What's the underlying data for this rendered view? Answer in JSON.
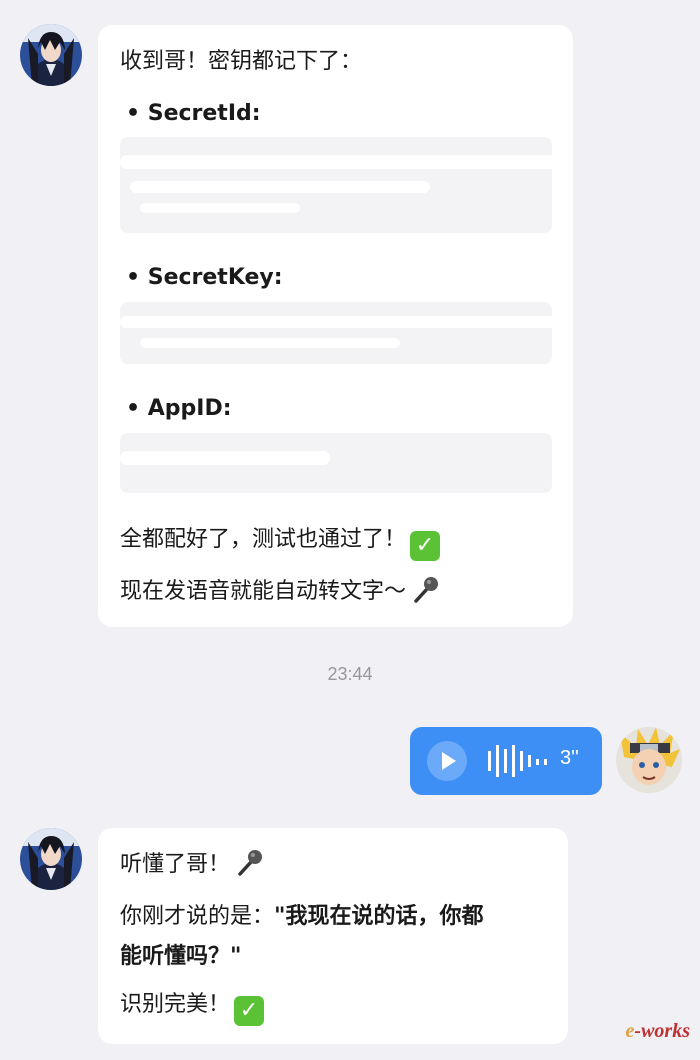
{
  "messages": {
    "first": {
      "intro": "收到哥！密钥都记下了：",
      "fields": [
        {
          "label": "SecretId:"
        },
        {
          "label": "SecretKey:"
        },
        {
          "label": "AppID:"
        }
      ],
      "line_done": "全都配好了，测试也通过了！",
      "line_voice": "现在发语音就能自动转文字～",
      "check_emoji": "✓",
      "mic_emoji": "mic-icon"
    },
    "timestamp": "23:44",
    "voice_message": {
      "duration": "3''",
      "play_icon": "play-icon",
      "wave_icon": "waveform-icon",
      "accent_color": "#3d8ff5"
    },
    "reply": {
      "line1": "听懂了哥！",
      "line2_prefix": "你刚才说的是：",
      "line2_quote": "\"我现在说的话，你都",
      "line3_quote": "能听懂吗？\"",
      "line4": "识别完美！",
      "check_emoji": "✓"
    }
  },
  "watermark": {
    "part1": "e",
    "part2": "-works"
  },
  "colors": {
    "background": "#f0f0f5",
    "bubble": "#ffffff",
    "check": "#5bc236"
  }
}
